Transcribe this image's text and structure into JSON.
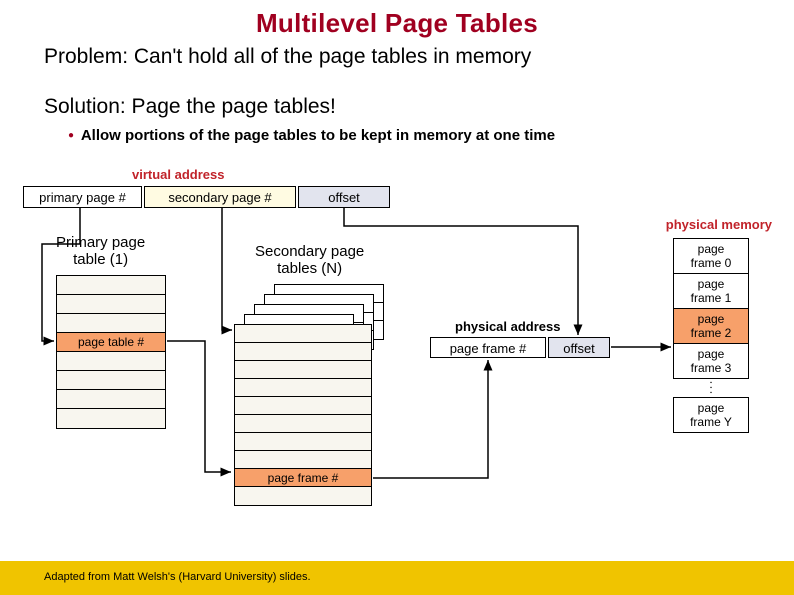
{
  "title": "Multilevel Page Tables",
  "problem": "Problem: Can't hold all of the page tables in memory",
  "solution": "Solution: Page the page tables!",
  "bullet": "Allow portions of the page tables to be kept in memory at one time",
  "virtual_address": {
    "label": "virtual address",
    "primary": "primary page #",
    "secondary": "secondary page #",
    "offset": "offset"
  },
  "phys_mem_label": "physical memory",
  "primary_table": {
    "label": "Primary page\ntable (1)",
    "selected_row_label": "page table #",
    "rows": 8,
    "selected_index": 3
  },
  "secondary_tables": {
    "label": "Secondary page\ntables (N)",
    "stacked_count": 5,
    "front_rows": 10,
    "selected_index": 8,
    "selected_row_label": "page frame #"
  },
  "physical_address": {
    "label": "physical address",
    "frame": "page frame #",
    "offset": "offset"
  },
  "physical_memory": {
    "frames": [
      "page\nframe 0",
      "page\nframe 1",
      "page\nframe 2",
      "page\nframe 3"
    ],
    "selected_index": 2,
    "last": "page\nframe Y"
  },
  "footer": "Adapted from Matt Welsh's (Harvard University) slides.",
  "colors": {
    "accent_red": "#a00020",
    "label_red": "#c1232a",
    "highlight": "#f7a06a",
    "footer_bg": "#f0c400"
  }
}
